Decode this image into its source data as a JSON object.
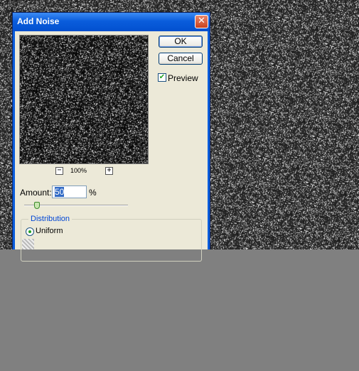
{
  "dialog": {
    "title": "Add Noise",
    "close_glyph": "✕",
    "close_icon": "close-icon"
  },
  "buttons": {
    "ok_label": "OK",
    "cancel_label": "Cancel"
  },
  "preview": {
    "label": "Preview",
    "checked": true,
    "check_glyph": "✔"
  },
  "zoom": {
    "level": "100%",
    "minus_glyph": "−",
    "plus_glyph": "+"
  },
  "amount": {
    "label": "Amount:",
    "value": "50",
    "unit": "%",
    "slider_fraction": 0.12
  },
  "distribution": {
    "title": "Distribution",
    "selected_option": "Uniform"
  },
  "colors": {
    "titlebar": "#0a5ddc",
    "dialog_bg": "#ece9d8",
    "background_noise": "#2e2e2e",
    "cover": "#808080",
    "accent_green": "#21a121"
  }
}
